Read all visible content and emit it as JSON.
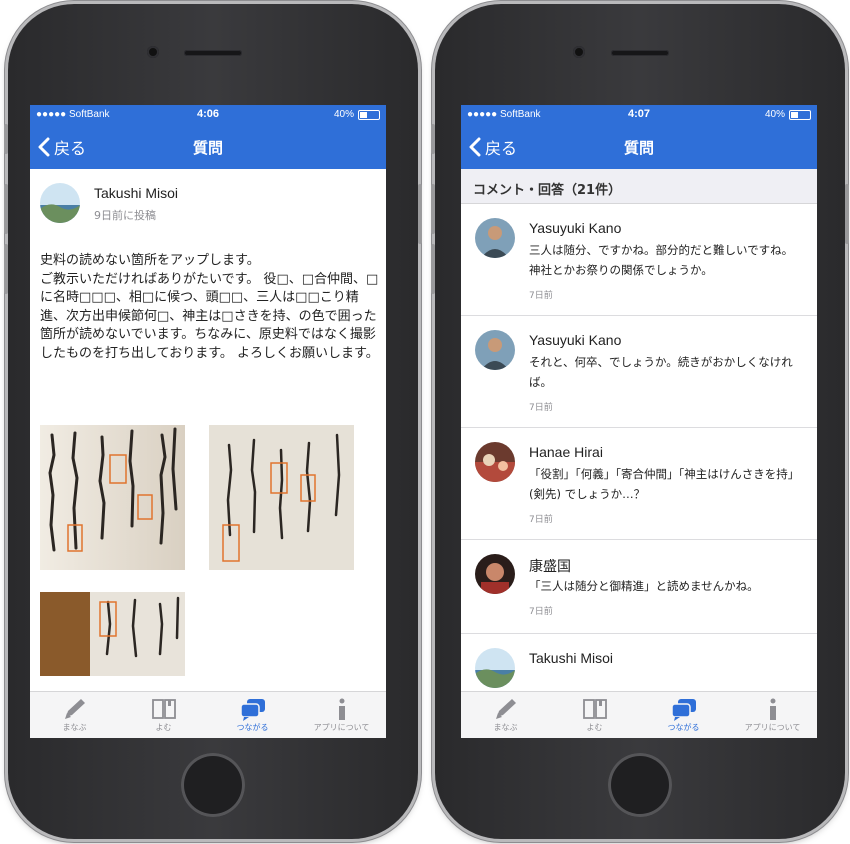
{
  "left_phone": {
    "status": {
      "carrier": "●●●●● SoftBank",
      "time": "4:06",
      "right": "40%"
    },
    "nav": {
      "back_label": "戻る",
      "title": "質問"
    },
    "post": {
      "author": "Takushi Misoi",
      "date": "9日前に投稿",
      "body": "史料の読めない箇所をアップします。\nご教示いただければありがたいです。 役□、□合仲間、□に名時□□□、相□に候つ、頭□□、三人は□□こり精進、次方出申候節何□、神主は□さきを持、の色で囲った箇所が読めないでいます。ちなみに、原史料ではなく撮影したものを打ち出しております。 よろしくお願いします。"
    },
    "tabs": [
      {
        "label": "まなぶ",
        "icon": "pencil-icon"
      },
      {
        "label": "よむ",
        "icon": "book-icon"
      },
      {
        "label": "つながる",
        "icon": "chat-bubbles-icon"
      },
      {
        "label": "アプリについて",
        "icon": "info-icon"
      }
    ]
  },
  "right_phone": {
    "status": {
      "carrier": "●●●●● SoftBank",
      "time": "4:07",
      "right": "40%"
    },
    "nav": {
      "back_label": "戻る",
      "title": "質問"
    },
    "section_header": "コメント・回答（21件）",
    "comments": [
      {
        "name": "Yasuyuki Kano",
        "text": "三人は随分、ですかね。部分的だと難しいですね。神社とかお祭りの関係でしょうか。",
        "date": "7日前"
      },
      {
        "name": "Yasuyuki Kano",
        "text": "それと、何卒、でしょうか。続きがおかしくなければ。",
        "date": "7日前"
      },
      {
        "name": "Hanae Hirai",
        "text": "「役割」「何義」「寄合仲間」「神主はけんさきを持」(剣先) でしょうか…？",
        "date": "7日前"
      },
      {
        "name": "康盛国",
        "text": "「三人は随分と御精進」と読めませんかね。",
        "date": "7日前"
      },
      {
        "name": "Takushi Misoi",
        "text": "",
        "date": ""
      }
    ],
    "tabs": [
      {
        "label": "まなぶ",
        "icon": "pencil-icon"
      },
      {
        "label": "よむ",
        "icon": "book-icon"
      },
      {
        "label": "つながる",
        "icon": "chat-bubbles-icon"
      },
      {
        "label": "アプリについて",
        "icon": "info-icon"
      }
    ]
  },
  "colors": {
    "accent": "#2f6fd8",
    "tab_inactive": "#8e8e93",
    "section_bg": "#efeff4"
  }
}
